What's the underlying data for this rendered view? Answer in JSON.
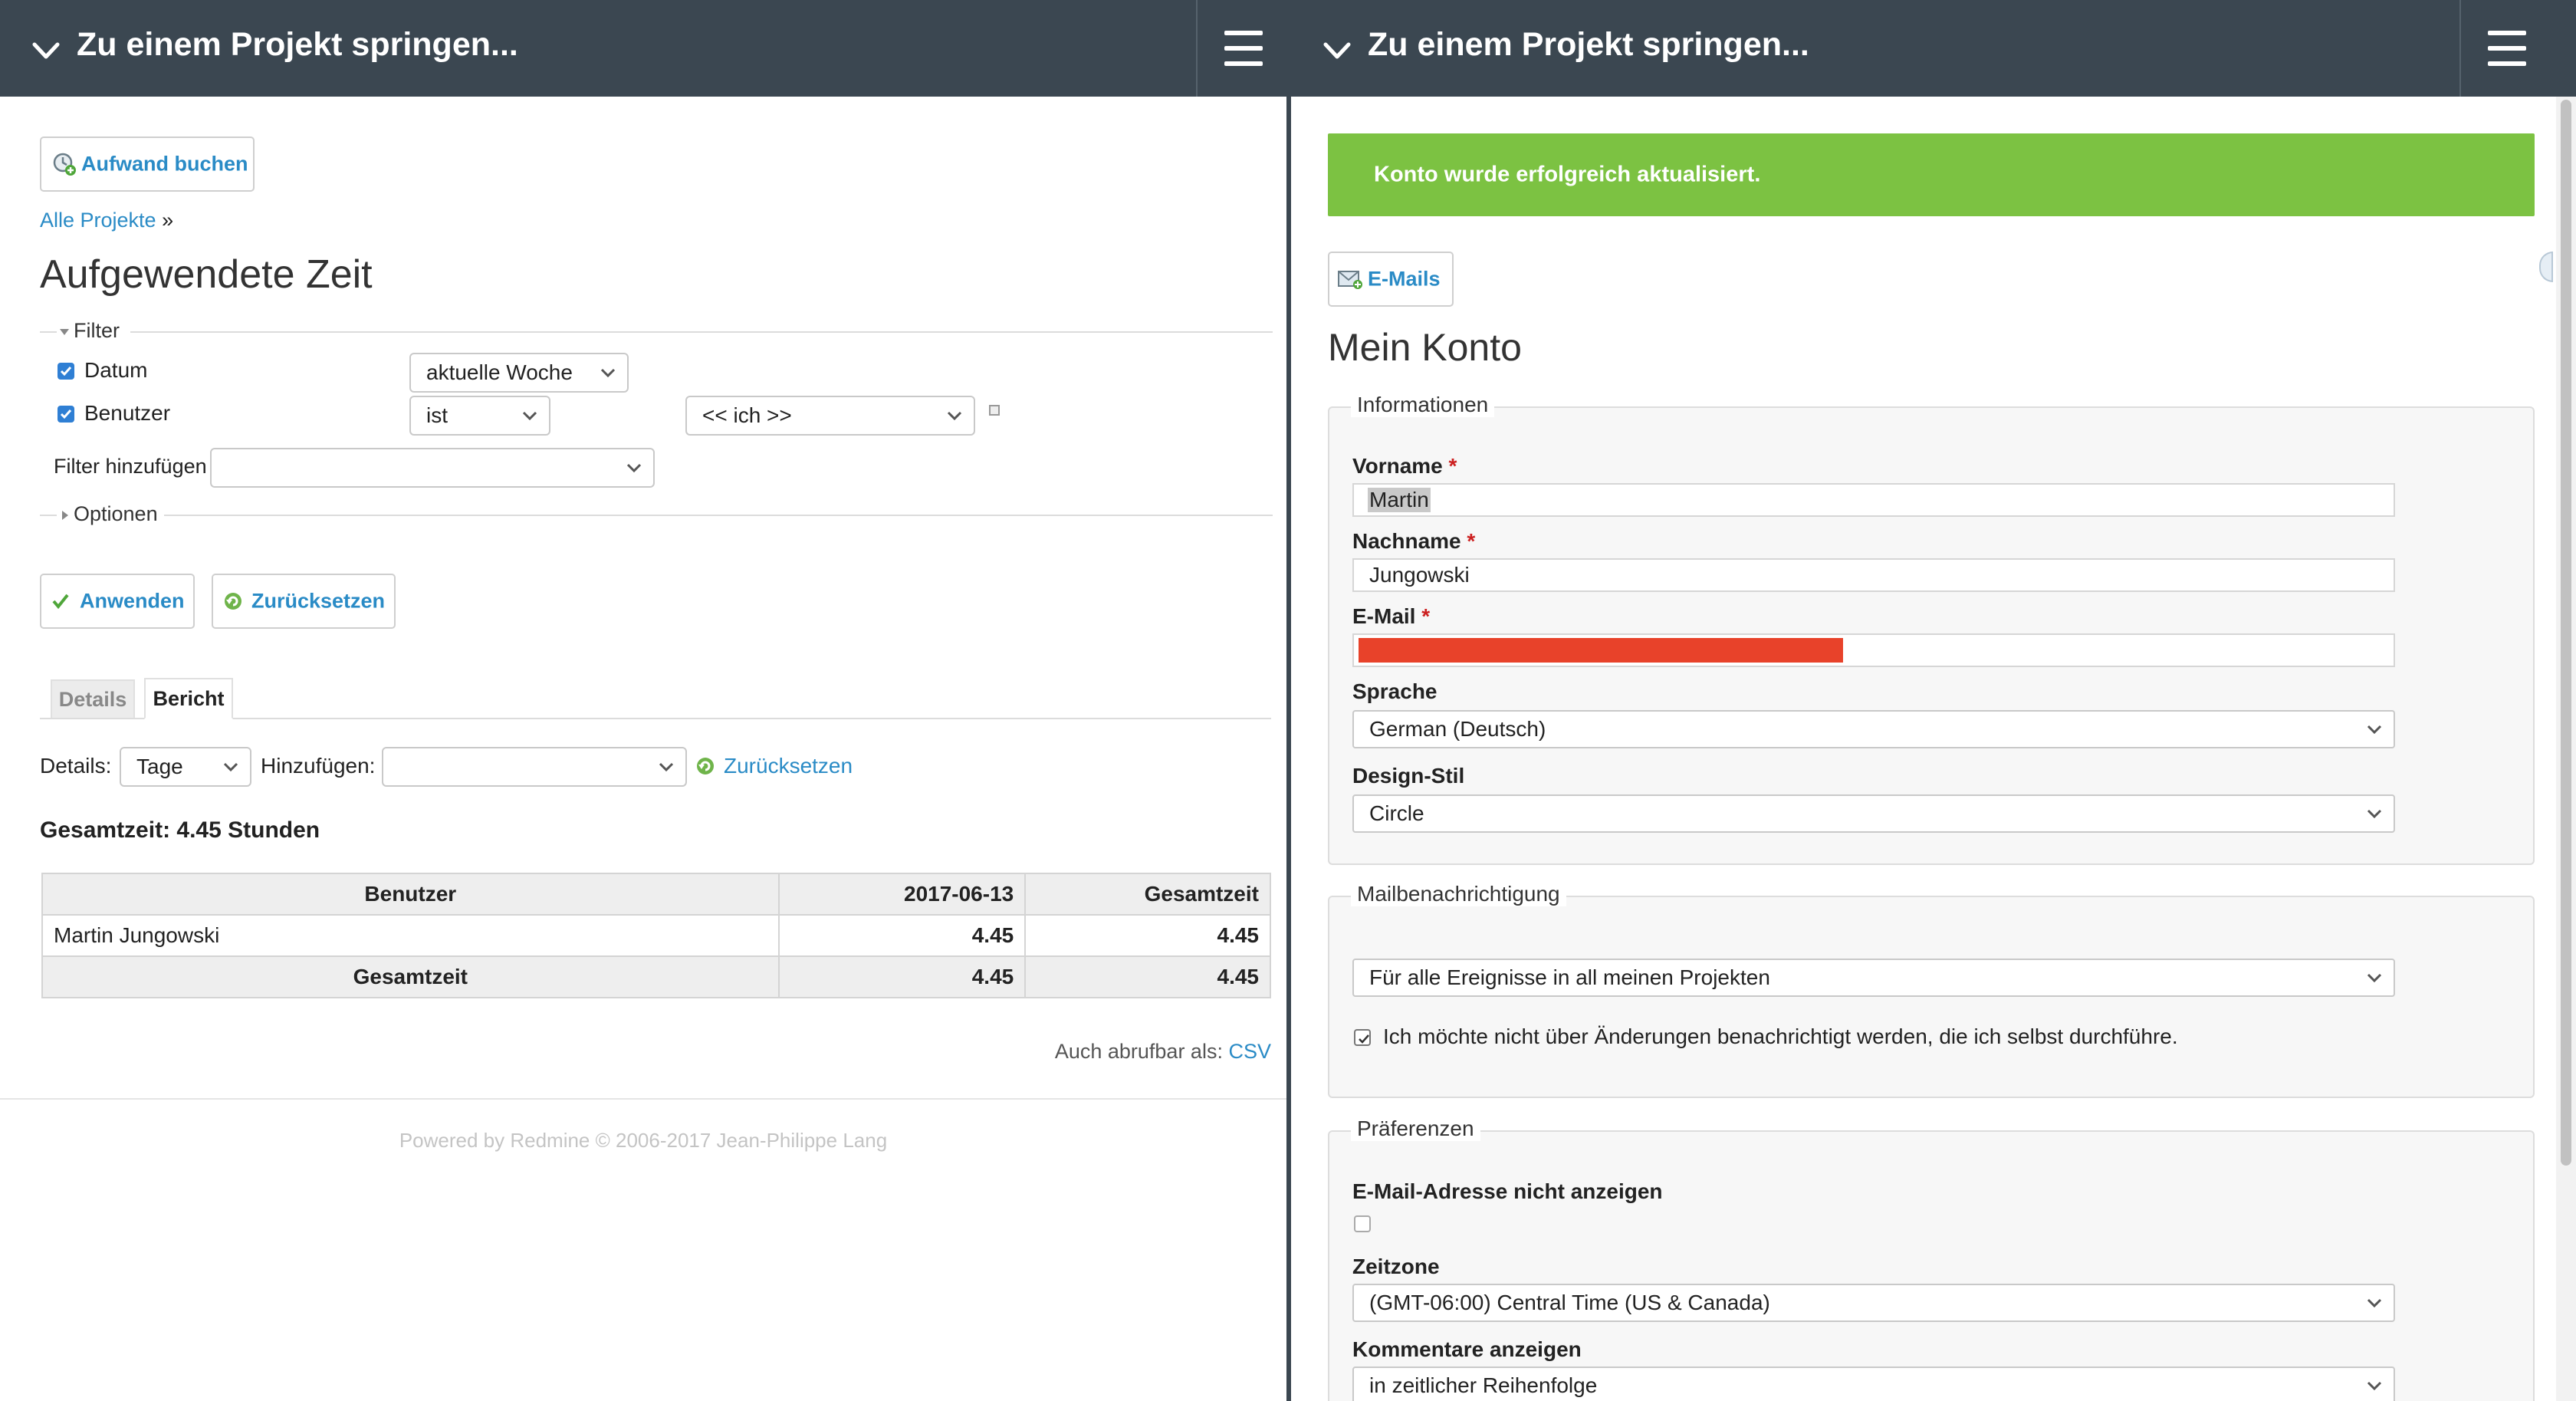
{
  "colors": {
    "topbar": "#3b4751",
    "link": "#2a8bc6",
    "flash_success": "#7cc242",
    "redacted": "#e8422a"
  },
  "left": {
    "topbar": {
      "jump_label": "Zu einem Projekt springen...",
      "chevron_icon": "chevron-down-icon",
      "menu_icon": "hamburger-menu-icon"
    },
    "log_time_button": "Aufwand buchen",
    "breadcrumb": {
      "link": "Alle Projekte",
      "separator": "»"
    },
    "page_title": "Aufgewendete Zeit",
    "filter": {
      "legend": "Filter",
      "rows": [
        {
          "label": "Datum",
          "checked": true,
          "operator": "aktuelle Woche"
        },
        {
          "label": "Benutzer",
          "checked": true,
          "operator": "ist",
          "value": "<< ich >>"
        }
      ],
      "add_filter_label": "Filter hinzufügen",
      "add_filter_value": ""
    },
    "options_legend": "Optionen",
    "apply_button": "Anwenden",
    "reset_button": "Zurücksetzen",
    "tabs": [
      {
        "label": "Details",
        "active": false
      },
      {
        "label": "Bericht",
        "active": true
      }
    ],
    "details_label": "Details:",
    "details_value": "Tage",
    "add_label": "Hinzufügen:",
    "add_value": "",
    "reset_link": "Zurücksetzen",
    "total": {
      "label": "Gesamtzeit:",
      "value": "4.45",
      "unit": "Stunden"
    },
    "report_table": {
      "headers": [
        "Benutzer",
        "2017-06-13",
        "Gesamtzeit"
      ],
      "rows": [
        [
          "Martin Jungowski",
          "4.45",
          "4.45"
        ]
      ],
      "total_row": [
        "Gesamtzeit",
        "4.45",
        "4.45"
      ]
    },
    "export": {
      "label": "Auch abrufbar als:",
      "csv": "CSV"
    },
    "footer": "Powered by Redmine © 2006-2017 Jean-Philippe Lang"
  },
  "right": {
    "topbar": {
      "jump_label": "Zu einem Projekt springen...",
      "chevron_icon": "chevron-down-icon",
      "menu_icon": "hamburger-menu-icon"
    },
    "flash": "Konto wurde erfolgreich aktualisiert.",
    "emails_button": "E-Mails",
    "page_title": "Mein Konto",
    "info": {
      "legend": "Informationen",
      "firstname_label": "Vorname",
      "firstname_value": "Martin",
      "lastname_label": "Nachname",
      "lastname_value": "Jungowski",
      "email_label": "E-Mail",
      "language_label": "Sprache",
      "language_value": "German (Deutsch)",
      "theme_label": "Design-Stil",
      "theme_value": "Circle",
      "required_mark": "*"
    },
    "mail": {
      "legend": "Mailbenachrichtigung",
      "option_value": "Für alle Ereignisse in all meinen Projekten",
      "no_self_checked": true,
      "no_self_label": "Ich möchte nicht über Änderungen benachrichtigt werden, die ich selbst durchführe."
    },
    "prefs": {
      "legend": "Präferenzen",
      "hide_email_label": "E-Mail-Adresse nicht anzeigen",
      "hide_email_checked": false,
      "timezone_label": "Zeitzone",
      "timezone_value": "(GMT-06:00) Central Time (US & Canada)",
      "comments_label": "Kommentare anzeigen",
      "comments_value": "in zeitlicher Reihenfolge"
    }
  }
}
